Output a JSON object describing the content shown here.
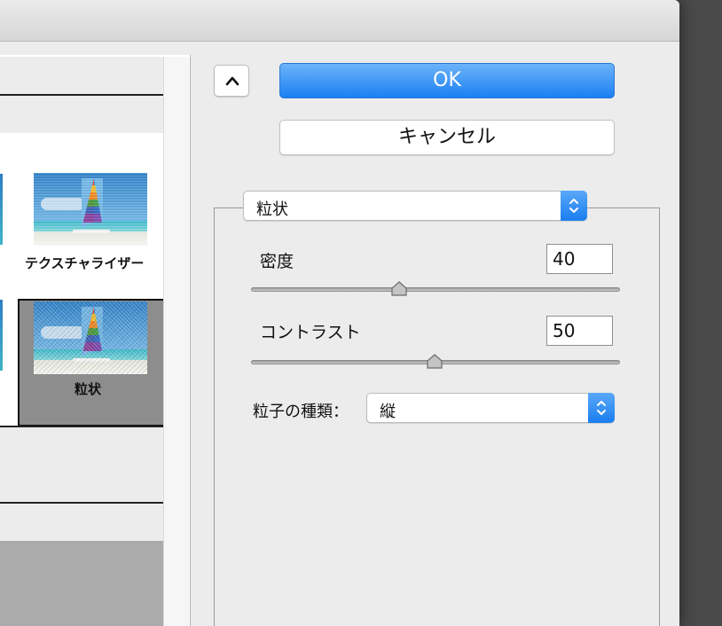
{
  "buttons": {
    "ok_label": "OK",
    "cancel_label": "キャンセル"
  },
  "filter": {
    "selected": "粒状"
  },
  "thumbnails": [
    {
      "label": "テクスチャライザー"
    },
    {
      "label": "粒状",
      "selected": true
    }
  ],
  "params": {
    "density_label": "密度",
    "density_value": "40",
    "contrast_label": "コントラスト",
    "contrast_value": "50",
    "grain_type_label": "粒子の種類：",
    "grain_type_value": "縦"
  },
  "icons": {
    "collapse": "chevron-up-icon",
    "dropdown": "up-down-arrows-icon"
  },
  "colors": {
    "accent": "#1b80f2",
    "selected_cell": "#8d8d8d"
  }
}
